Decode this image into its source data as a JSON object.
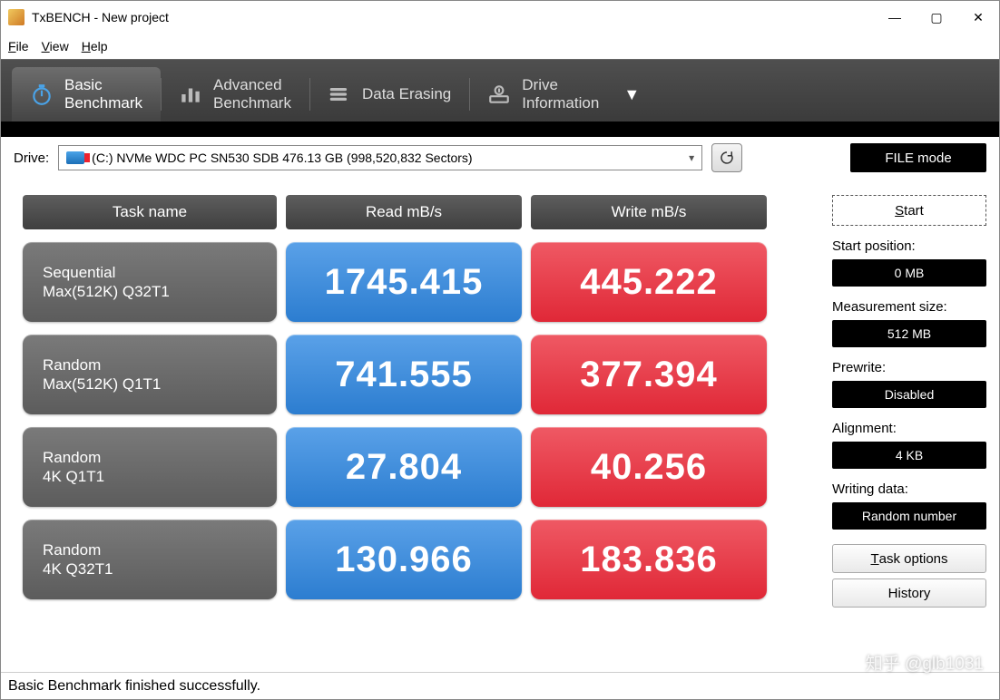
{
  "window": {
    "title": "TxBENCH - New project"
  },
  "menu": {
    "file": "File",
    "view": "View",
    "help": "Help"
  },
  "tabs": {
    "basic": "Basic\nBenchmark",
    "advanced": "Advanced\nBenchmark",
    "erase": "Data Erasing",
    "driveinfo": "Drive\nInformation"
  },
  "drivebar": {
    "label": "Drive:",
    "selected": "(C:) NVMe WDC PC SN530 SDB  476.13 GB (998,520,832 Sectors)",
    "filemode": "FILE mode"
  },
  "headers": {
    "task": "Task name",
    "read": "Read mB/s",
    "write": "Write mB/s"
  },
  "rows": [
    {
      "name1": "Sequential",
      "name2": "Max(512K) Q32T1",
      "read": "1745.415",
      "write": "445.222"
    },
    {
      "name1": "Random",
      "name2": "Max(512K) Q1T1",
      "read": "741.555",
      "write": "377.394"
    },
    {
      "name1": "Random",
      "name2": "4K Q1T1",
      "read": "27.804",
      "write": "40.256"
    },
    {
      "name1": "Random",
      "name2": "4K Q32T1",
      "read": "130.966",
      "write": "183.836"
    }
  ],
  "side": {
    "start": "Start",
    "startpos_lbl": "Start position:",
    "startpos_val": "0 MB",
    "meassize_lbl": "Measurement size:",
    "meassize_val": "512 MB",
    "prewrite_lbl": "Prewrite:",
    "prewrite_val": "Disabled",
    "align_lbl": "Alignment:",
    "align_val": "4 KB",
    "writedata_lbl": "Writing data:",
    "writedata_val": "Random number",
    "taskopt": "Task options",
    "history": "History"
  },
  "status": "Basic Benchmark finished successfully.",
  "watermark": "知乎 @glb1031"
}
